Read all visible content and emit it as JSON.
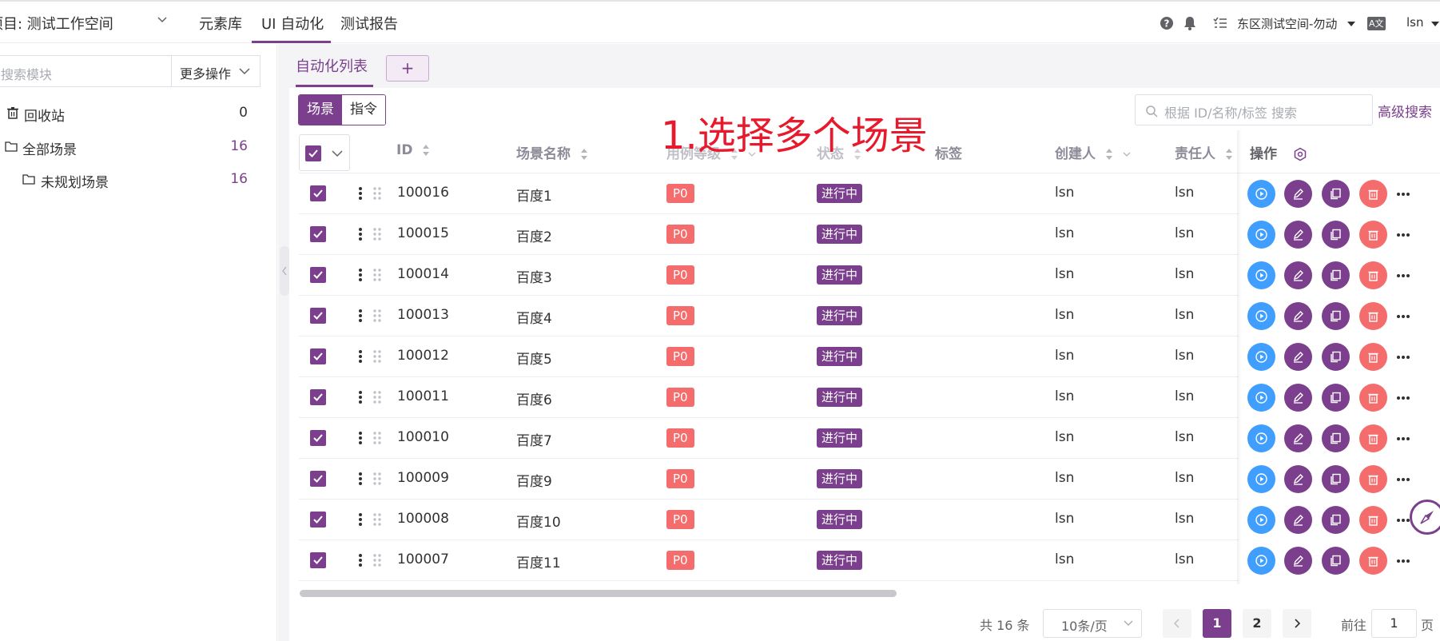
{
  "header": {
    "project_label": "项目: 测试工作空间",
    "nav": [
      "元素库",
      "UI 自动化",
      "测试报告"
    ],
    "workspace": "东区测试空间-勿动",
    "lang_label": "A文",
    "user": "lsn"
  },
  "sidebar": {
    "search_placeholder": "搜索模块",
    "more_ops": "更多操作",
    "tree": [
      {
        "label": "回收站",
        "count": "0"
      },
      {
        "label": "全部场景",
        "count": "16"
      },
      {
        "label": "未规划场景",
        "count": "16"
      }
    ]
  },
  "main": {
    "tab_label": "自动化列表",
    "tab_add": "+",
    "segment": [
      "场景",
      "指令"
    ],
    "annotation": "1.选择多个场景",
    "search_placeholder": "根据 ID/名称/标签 搜索",
    "advanced_search": "高级搜索",
    "columns": {
      "id": "ID",
      "name": "场景名称",
      "level": "用例等级",
      "status": "状态",
      "tags": "标签",
      "creator": "创建人",
      "owner": "责任人",
      "ops": "操作"
    },
    "rows": [
      {
        "id": "100016",
        "name": "百度1",
        "level": "P0",
        "status": "进行中",
        "creator": "lsn",
        "owner": "lsn"
      },
      {
        "id": "100015",
        "name": "百度2",
        "level": "P0",
        "status": "进行中",
        "creator": "lsn",
        "owner": "lsn"
      },
      {
        "id": "100014",
        "name": "百度3",
        "level": "P0",
        "status": "进行中",
        "creator": "lsn",
        "owner": "lsn"
      },
      {
        "id": "100013",
        "name": "百度4",
        "level": "P0",
        "status": "进行中",
        "creator": "lsn",
        "owner": "lsn"
      },
      {
        "id": "100012",
        "name": "百度5",
        "level": "P0",
        "status": "进行中",
        "creator": "lsn",
        "owner": "lsn"
      },
      {
        "id": "100011",
        "name": "百度6",
        "level": "P0",
        "status": "进行中",
        "creator": "lsn",
        "owner": "lsn"
      },
      {
        "id": "100010",
        "name": "百度7",
        "level": "P0",
        "status": "进行中",
        "creator": "lsn",
        "owner": "lsn"
      },
      {
        "id": "100009",
        "name": "百度9",
        "level": "P0",
        "status": "进行中",
        "creator": "lsn",
        "owner": "lsn"
      },
      {
        "id": "100008",
        "name": "百度10",
        "level": "P0",
        "status": "进行中",
        "creator": "lsn",
        "owner": "lsn"
      },
      {
        "id": "100007",
        "name": "百度11",
        "level": "P0",
        "status": "进行中",
        "creator": "lsn",
        "owner": "lsn"
      }
    ]
  },
  "pagination": {
    "total": "共 16 条",
    "page_size": "10条/页",
    "pages": [
      "1",
      "2"
    ],
    "current": "1",
    "goto_label": "前往",
    "goto_value": "1",
    "page_suffix": "页"
  },
  "colors": {
    "accent": "#7b3f8e",
    "run": "#409eff",
    "danger": "#f56c6c"
  }
}
